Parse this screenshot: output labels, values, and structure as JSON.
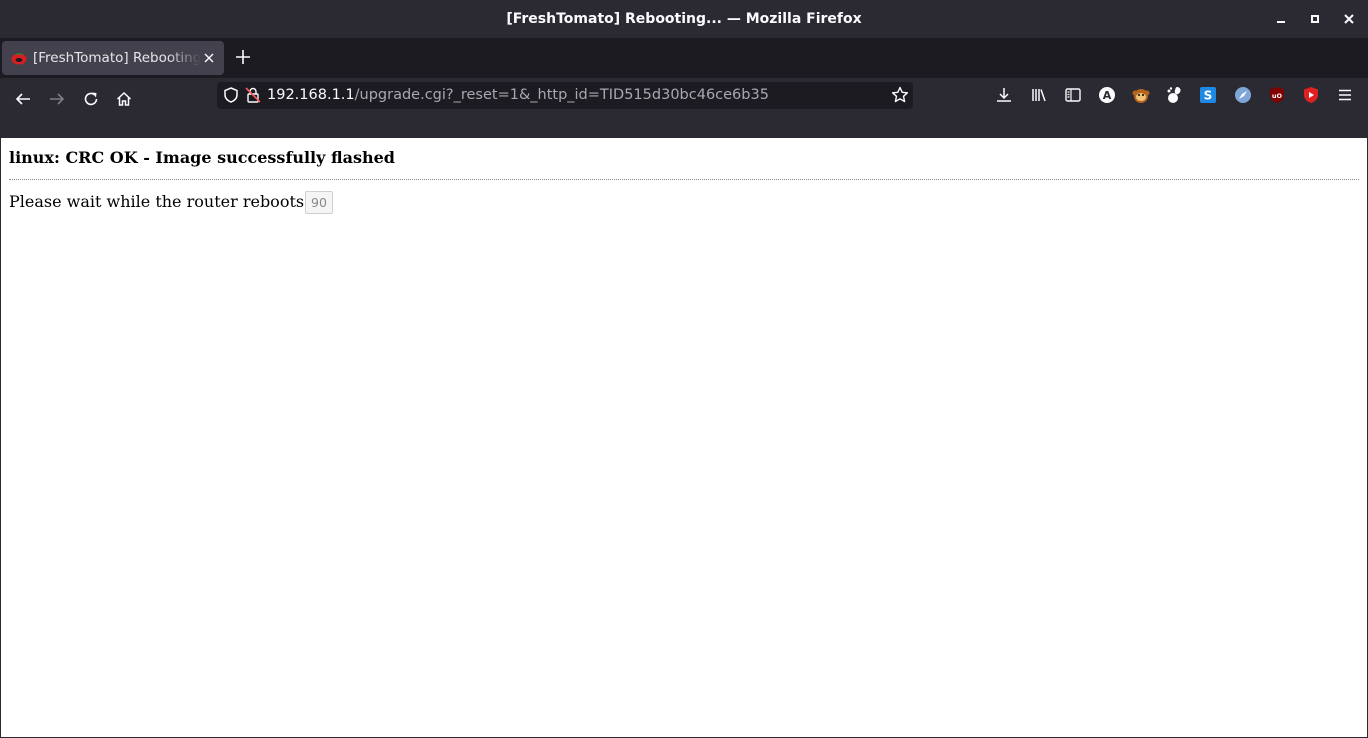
{
  "window": {
    "title": "[FreshTomato] Rebooting... — Mozilla Firefox"
  },
  "tab": {
    "title": "[FreshTomato] Rebooting..."
  },
  "urlbar": {
    "host": "192.168.1.1",
    "path": "/upgrade.cgi?_reset=1&_http_id=TID515d30bc46ce6b35"
  },
  "toolbar": {
    "extension_icons": [
      "download-icon",
      "library-icon",
      "sidebar-icon",
      "a-extension-icon",
      "monkey-extension-icon",
      "gnome-extension-icon",
      "s-extension-icon",
      "compass-extension-icon",
      "ublock-origin-icon",
      "youtube-extension-icon",
      "menu-icon"
    ]
  },
  "page": {
    "heading": "linux: CRC OK - Image successfully flashed",
    "message": "Please wait while the router reboots...",
    "countdown": "90"
  },
  "colors": {
    "chrome_bg": "#2b2a33",
    "tabstrip_bg": "#1c1b22",
    "active_tab": "#42414d",
    "page_bg": "#ffffff"
  }
}
